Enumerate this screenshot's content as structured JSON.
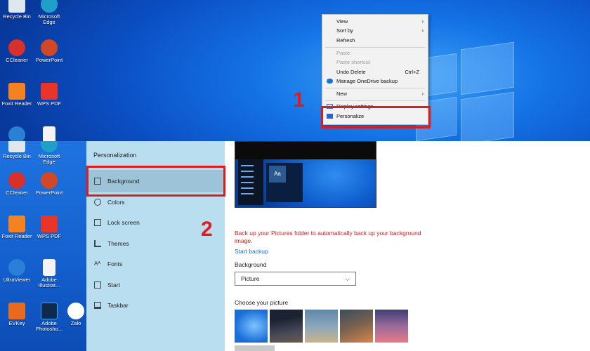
{
  "desktop_top": {
    "icons": [
      {
        "label": "Recycle Bin",
        "icon": "recycle-bin-icon",
        "color": "#dfe7ee"
      },
      {
        "label": "Microsoft Edge",
        "icon": "edge-icon",
        "color": "#1fa0c8"
      },
      {
        "label": "CCleaner",
        "icon": "ccleaner-icon",
        "color": "#d8302a"
      },
      {
        "label": "PowerPoint",
        "icon": "powerpoint-icon",
        "color": "#d24726"
      },
      {
        "label": "Foxit Reader",
        "icon": "foxit-icon",
        "color": "#f58220"
      },
      {
        "label": "WPS PDF",
        "icon": "wps-pdf-icon",
        "color": "#e8352a"
      }
    ]
  },
  "context_menu": {
    "items": [
      {
        "label": "View",
        "submenu": true,
        "disabled": false
      },
      {
        "label": "Sort by",
        "submenu": true,
        "disabled": false
      },
      {
        "label": "Refresh",
        "disabled": false
      },
      {
        "label": "Paste",
        "disabled": true
      },
      {
        "label": "Paste shortcut",
        "disabled": true
      },
      {
        "label": "Undo Delete",
        "shortcut": "Ctrl+Z",
        "disabled": false
      },
      {
        "label": "Manage OneDrive backup",
        "icon": "onedrive-icon",
        "disabled": false
      },
      {
        "label": "New",
        "submenu": true,
        "disabled": false
      },
      {
        "label": "Display settings",
        "icon": "display-icon",
        "disabled": false
      },
      {
        "label": "Personalize",
        "icon": "personalize-icon",
        "disabled": false
      }
    ]
  },
  "steps": {
    "one": "1",
    "two": "2"
  },
  "desktop_bottom": {
    "icons": [
      {
        "label": "Recycle Bin",
        "icon": "recycle-bin-icon",
        "color": "#dfe7ee"
      },
      {
        "label": "Microsoft Edge",
        "icon": "edge-icon",
        "color": "#1fa0c8"
      },
      {
        "label": "CCleaner",
        "icon": "ccleaner-icon",
        "color": "#d8302a"
      },
      {
        "label": "PowerPoint",
        "icon": "powerpoint-icon",
        "color": "#d24726"
      },
      {
        "label": "Foxit Reader",
        "icon": "foxit-icon",
        "color": "#f58220"
      },
      {
        "label": "WPS PDF",
        "icon": "wps-pdf-icon",
        "color": "#e8352a"
      },
      {
        "label": "UltraViewer",
        "icon": "ultraviewer-icon",
        "color": "#2a7fd6"
      },
      {
        "label": "Adobe Illustrat...",
        "icon": "adobe-file-icon",
        "color": "#f4f4f4"
      },
      {
        "label": "EVKey",
        "icon": "evkey-icon",
        "color": "#e96a1e"
      },
      {
        "label": "Adobe Photosho...",
        "icon": "photoshop-icon",
        "color": "#0f2a4a"
      },
      {
        "label": "Zalo",
        "icon": "zalo-icon",
        "color": "#ffffff"
      }
    ]
  },
  "personalization": {
    "title": "Personalization",
    "nav": [
      {
        "label": "Background",
        "icon": "picture-icon",
        "selected": true
      },
      {
        "label": "Colors",
        "icon": "palette-icon",
        "selected": false
      },
      {
        "label": "Lock screen",
        "icon": "lock-screen-icon",
        "selected": false
      },
      {
        "label": "Themes",
        "icon": "brush-icon",
        "selected": false
      },
      {
        "label": "Fonts",
        "icon": "font-icon",
        "selected": false
      },
      {
        "label": "Start",
        "icon": "start-icon",
        "selected": false
      },
      {
        "label": "Taskbar",
        "icon": "taskbar-icon",
        "selected": false
      }
    ],
    "preview_sample": "Aa",
    "warning": "Back up your Pictures folder to automatically back up your background image.",
    "start_backup": "Start backup",
    "background_label": "Background",
    "background_value": "Picture",
    "choose_label": "Choose your picture",
    "pictures": [
      {
        "name": "windows-default-thumbnail",
        "colors": [
          "#1a6ed8",
          "#7ec3ff"
        ]
      },
      {
        "name": "night-sky-thumbnail",
        "colors": [
          "#1b2333",
          "#6a5a4a"
        ]
      },
      {
        "name": "beach-rocks-thumbnail",
        "colors": [
          "#5e88a8",
          "#c9b48a"
        ]
      },
      {
        "name": "waterfall-coast-thumbnail",
        "colors": [
          "#3a4c5e",
          "#d9874a"
        ]
      },
      {
        "name": "sunset-beach-thumbnail",
        "colors": [
          "#3e3f74",
          "#e87a8a"
        ]
      }
    ]
  },
  "colors": {
    "accent_red": "#e11b1b",
    "link_blue": "#1a6fc2",
    "sidebar_bg": "#b9def0"
  }
}
